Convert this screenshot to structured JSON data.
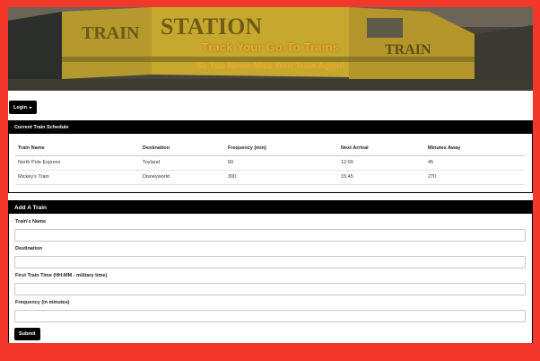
{
  "hero": {
    "title": "Track Your Go-To Trains",
    "subtitle": "So You Never Miss Your Train Again!",
    "background_text": {
      "train_left": "TRAIN",
      "station": "STATION",
      "train_right": "TRAIN"
    }
  },
  "login": {
    "label": "Login"
  },
  "schedule": {
    "heading": "Current Train Schedule",
    "columns": [
      "Train Name",
      "Destination",
      "Frequency (min)",
      "Next Arrival",
      "Minutes Away"
    ],
    "rows": [
      [
        "North Pole Express",
        "Toyland",
        "60",
        "12:00",
        "45"
      ],
      [
        "Mickey's Train",
        "Disneyworld",
        "300",
        "15:45",
        "270"
      ]
    ]
  },
  "add_train": {
    "heading": "Add A Train",
    "fields": [
      {
        "label": "Train's Name",
        "value": ""
      },
      {
        "label": "Destination",
        "value": ""
      },
      {
        "label": "First Train Time (HH:MM - military time)",
        "value": ""
      },
      {
        "label": "Frequency (in minutes)",
        "value": ""
      }
    ],
    "submit_label": "Submit"
  },
  "colors": {
    "frame": "#f2382b",
    "accent_text": "#f0a82a",
    "button_bg": "#000000"
  }
}
